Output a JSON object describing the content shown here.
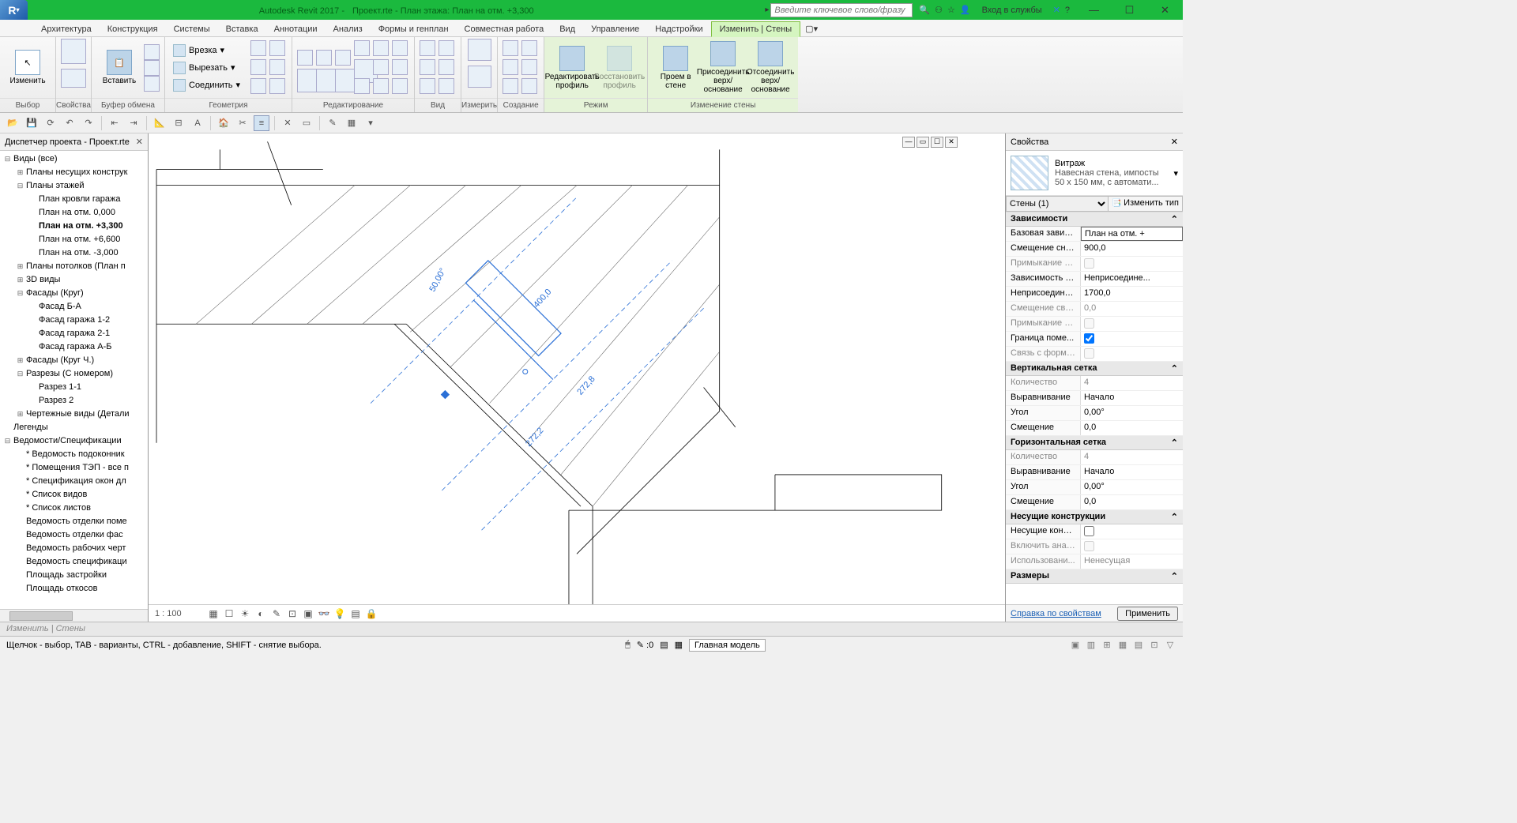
{
  "title_bar": {
    "app": "Autodesk Revit 2017 -",
    "doc": "Проект.rte - План этажа: План на отм. +3,300",
    "search_placeholder": "Введите ключевое слово/фразу",
    "login": "Вход в службы"
  },
  "ribbon_tabs": [
    "Архитектура",
    "Конструкция",
    "Системы",
    "Вставка",
    "Аннотации",
    "Анализ",
    "Формы и генплан",
    "Совместная работа",
    "Вид",
    "Управление",
    "Надстройки",
    "Изменить | Стены"
  ],
  "ribbon": {
    "panels": {
      "select": {
        "title": "Выбор",
        "btn": "Изменить"
      },
      "props": {
        "title": "Свойства"
      },
      "clipboard": {
        "title": "Буфер обмена",
        "paste": "Вставить"
      },
      "geometry": {
        "title": "Геометрия",
        "cope": "Врезка",
        "cut": "Вырезать",
        "join": "Соединить"
      },
      "modify": {
        "title": "Редактирование"
      },
      "view": {
        "title": "Вид"
      },
      "measure": {
        "title": "Измерить"
      },
      "create": {
        "title": "Создание"
      },
      "mode": {
        "title": "Режим",
        "edit_profile": "Редактировать профиль",
        "reset_profile": "Восстановить профиль"
      },
      "wall_mod": {
        "title": "Изменение стены",
        "opening": "Проем в стене",
        "attach": "Присоединить верх/основание",
        "detach": "Отсоединить верх/основание"
      }
    }
  },
  "project_browser": {
    "title": "Диспетчер проекта - Проект.rte",
    "tree": [
      {
        "l": 0,
        "exp": "-",
        "ico": "v",
        "label": "Виды (все)"
      },
      {
        "l": 1,
        "exp": "+",
        "label": "Планы несущих конструк"
      },
      {
        "l": 1,
        "exp": "-",
        "label": "Планы этажей"
      },
      {
        "l": 2,
        "label": "План кровли гаража"
      },
      {
        "l": 2,
        "label": "План на отм. 0,000"
      },
      {
        "l": 2,
        "label": "План на отм. +3,300",
        "bold": true
      },
      {
        "l": 2,
        "label": "План на отм. +6,600"
      },
      {
        "l": 2,
        "label": "План на отм. -3,000"
      },
      {
        "l": 1,
        "exp": "+",
        "label": "Планы потолков (План п"
      },
      {
        "l": 1,
        "exp": "+",
        "label": "3D виды"
      },
      {
        "l": 1,
        "exp": "-",
        "label": "Фасады (Круг)"
      },
      {
        "l": 2,
        "label": "Фасад Б-А"
      },
      {
        "l": 2,
        "label": "Фасад гаража 1-2"
      },
      {
        "l": 2,
        "label": "Фасад гаража 2-1"
      },
      {
        "l": 2,
        "label": "Фасад гаража А-Б"
      },
      {
        "l": 1,
        "exp": "+",
        "label": "Фасады (Круг Ч.)"
      },
      {
        "l": 1,
        "exp": "-",
        "label": "Разрезы (С номером)"
      },
      {
        "l": 2,
        "label": "Разрез 1-1"
      },
      {
        "l": 2,
        "label": "Разрез 2"
      },
      {
        "l": 1,
        "exp": "+",
        "label": "Чертежные виды (Детали"
      },
      {
        "l": 0,
        "ico": "l",
        "label": "Легенды"
      },
      {
        "l": 0,
        "exp": "-",
        "ico": "s",
        "label": "Ведомости/Спецификации"
      },
      {
        "l": 1,
        "label": "* Ведомость подоконник"
      },
      {
        "l": 1,
        "label": "* Помещения ТЭП - все п"
      },
      {
        "l": 1,
        "label": "* Спецификация окон дл"
      },
      {
        "l": 1,
        "label": "* Список видов"
      },
      {
        "l": 1,
        "label": "* Список листов"
      },
      {
        "l": 1,
        "label": "Ведомость отделки поме"
      },
      {
        "l": 1,
        "label": "Ведомость отделки фас"
      },
      {
        "l": 1,
        "label": "Ведомость рабочих черт"
      },
      {
        "l": 1,
        "label": "Ведомость спецификаци"
      },
      {
        "l": 1,
        "label": "Площадь застройки"
      },
      {
        "l": 1,
        "label": "Площадь откосов"
      }
    ]
  },
  "canvas": {
    "scale": "1 : 100",
    "dimensions": {
      "d1": "50,00°",
      "d2": "400,0",
      "d3": "272,8",
      "d4": "272,2"
    }
  },
  "properties": {
    "title": "Свойства",
    "type_name": "Витраж",
    "type_desc": "Навесная стена, импосты 50 х 150 мм, с автомати...",
    "selector": "Стены (1)",
    "edit_type": "Изменить тип",
    "groups": [
      {
        "name": "Зависимости",
        "rows": [
          {
            "k": "Базовая завис...",
            "v": "План на отм. +",
            "boxed": true
          },
          {
            "k": "Смещение сни...",
            "v": "900,0"
          },
          {
            "k": "Примыкание с...",
            "v": "",
            "ro": true,
            "cb": false
          },
          {
            "k": "Зависимость с...",
            "v": "Неприсоедине..."
          },
          {
            "k": "Неприсоедине...",
            "v": "1700,0"
          },
          {
            "k": "Смещение све...",
            "v": "0,0",
            "ro": true
          },
          {
            "k": "Примыкание с...",
            "v": "",
            "ro": true,
            "cb": false
          },
          {
            "k": "Граница поме...",
            "v": "",
            "cb": true
          },
          {
            "k": "Связь с формо...",
            "v": "",
            "ro": true,
            "cb": false
          }
        ]
      },
      {
        "name": "Вертикальная сетка",
        "rows": [
          {
            "k": "Количество",
            "v": "4",
            "ro": true
          },
          {
            "k": "Выравнивание",
            "v": "Начало"
          },
          {
            "k": "Угол",
            "v": "0,00°"
          },
          {
            "k": "Смещение",
            "v": "0,0"
          }
        ]
      },
      {
        "name": "Горизонтальная сетка",
        "rows": [
          {
            "k": "Количество",
            "v": "4",
            "ro": true
          },
          {
            "k": "Выравнивание",
            "v": "Начало"
          },
          {
            "k": "Угол",
            "v": "0,00°"
          },
          {
            "k": "Смещение",
            "v": "0,0"
          }
        ]
      },
      {
        "name": "Несущие конструкции",
        "rows": [
          {
            "k": "Несущие конст...",
            "v": "",
            "cb": false
          },
          {
            "k": "Включить анал...",
            "v": "",
            "ro": true,
            "cb": false
          },
          {
            "k": "Использовани...",
            "v": "Ненесущая",
            "ro": true
          }
        ]
      },
      {
        "name": "Размеры",
        "rows": []
      }
    ],
    "help_link": "Справка по свойствам",
    "apply": "Применить"
  },
  "edit_bar": "Изменить | Стены",
  "status": {
    "hint": "Щелчок - выбор, TAB - варианты, CTRL - добавление, SHIFT - снятие выбора.",
    "count": ":0",
    "model": "Главная модель"
  }
}
